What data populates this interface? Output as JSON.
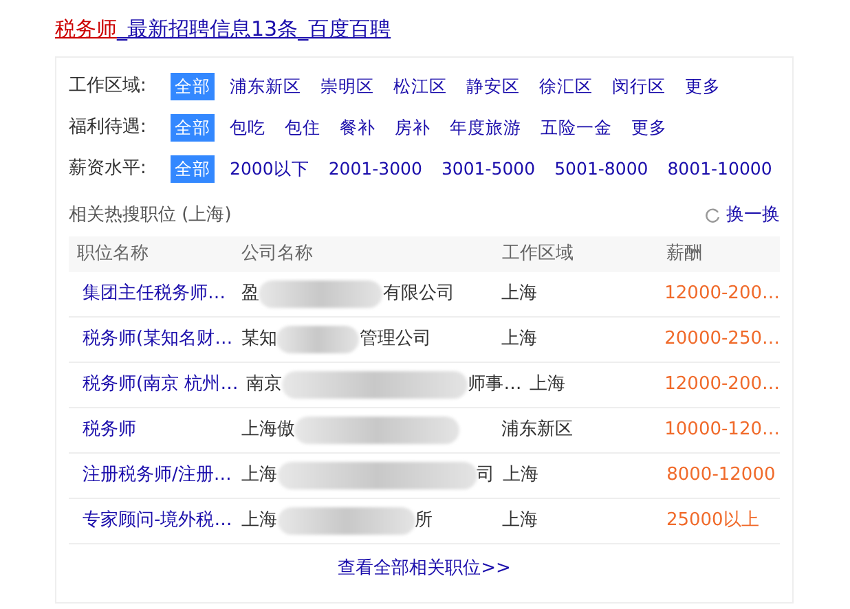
{
  "title": {
    "keyword": "税务师",
    "rest": "_最新招聘信息13条_百度百聘"
  },
  "filters": [
    {
      "label": "工作区域:",
      "options": [
        {
          "text": "全部",
          "selected": true
        },
        {
          "text": "浦东新区",
          "selected": false
        },
        {
          "text": "崇明区",
          "selected": false
        },
        {
          "text": "松江区",
          "selected": false
        },
        {
          "text": "静安区",
          "selected": false
        },
        {
          "text": "徐汇区",
          "selected": false
        },
        {
          "text": "闵行区",
          "selected": false
        },
        {
          "text": "更多",
          "selected": false
        }
      ]
    },
    {
      "label": "福利待遇:",
      "options": [
        {
          "text": "全部",
          "selected": true
        },
        {
          "text": "包吃",
          "selected": false
        },
        {
          "text": "包住",
          "selected": false
        },
        {
          "text": "餐补",
          "selected": false
        },
        {
          "text": "房补",
          "selected": false
        },
        {
          "text": "年度旅游",
          "selected": false
        },
        {
          "text": "五险一金",
          "selected": false
        },
        {
          "text": "更多",
          "selected": false
        }
      ]
    },
    {
      "label": "薪资水平:",
      "options": [
        {
          "text": "全部",
          "selected": true
        },
        {
          "text": "2000以下",
          "selected": false
        },
        {
          "text": "2001-3000",
          "selected": false
        },
        {
          "text": "3001-5000",
          "selected": false
        },
        {
          "text": "5001-8000",
          "selected": false
        },
        {
          "text": "8001-10000",
          "selected": false
        }
      ]
    }
  ],
  "hot": {
    "heading": "相关热搜职位 (上海)",
    "refresh": "换一换"
  },
  "table": {
    "columns": [
      "职位名称",
      "公司名称",
      "工作区域",
      "薪酬"
    ],
    "rows": [
      {
        "job": "集团主任税务师…",
        "company_start": "盈",
        "company_end": "有限公司",
        "area": "上海",
        "salary": "12000-200…"
      },
      {
        "job": "税务师(某知名财…",
        "company_start": "某知",
        "company_end": "管理公司",
        "area": "上海",
        "salary": "20000-250…"
      },
      {
        "job": "税务师(南京 杭州…",
        "company_start": "南京",
        "company_end": "师事…",
        "area": "上海",
        "salary": "12000-200…"
      },
      {
        "job": "税务师",
        "company_start": "上海傲",
        "area": "浦东新区",
        "salary": "10000-120…"
      },
      {
        "job": "注册税务师/注册…",
        "company_start": "上海",
        "company_end": "司",
        "area": "上海",
        "salary": "8000-12000"
      },
      {
        "job": "专家顾问-境外税…",
        "company_start": "上海",
        "company_end": "所",
        "area": "上海",
        "salary": "25000以上"
      }
    ]
  },
  "more_link": "查看全部相关职位>>"
}
